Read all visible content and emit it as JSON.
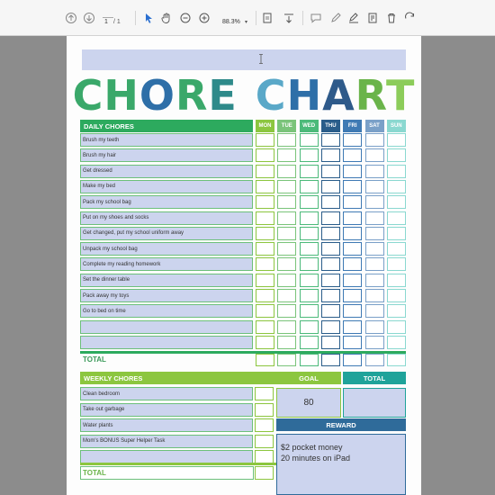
{
  "toolbar": {
    "page_current": "1",
    "page_total": "/ 1",
    "zoom": "88.3%"
  },
  "title": {
    "letters": [
      {
        "ch": "C",
        "color": "#3aa86a"
      },
      {
        "ch": "H",
        "color": "#3aa86a"
      },
      {
        "ch": "O",
        "color": "#2e6fa8"
      },
      {
        "ch": "R",
        "color": "#3aa86a"
      },
      {
        "ch": "E",
        "color": "#2e8a8a"
      },
      {
        "ch": " ",
        "color": "#000000"
      },
      {
        "ch": "C",
        "color": "#5aa8c8"
      },
      {
        "ch": "H",
        "color": "#2e6fa8"
      },
      {
        "ch": "A",
        "color": "#2e5a8a"
      },
      {
        "ch": "R",
        "color": "#6ab44a"
      },
      {
        "ch": "T",
        "color": "#8ccc5a"
      }
    ]
  },
  "daily": {
    "header": "DAILY CHORES",
    "days": [
      {
        "label": "MON",
        "color": "#8cc63f",
        "box": "#8cc63f"
      },
      {
        "label": "TUE",
        "color": "#7ac47a",
        "box": "#7ac47a"
      },
      {
        "label": "WED",
        "color": "#4cba7a",
        "box": "#4cba7a"
      },
      {
        "label": "THU",
        "color": "#2a5d8a",
        "box": "#2a5d8a"
      },
      {
        "label": "FRI",
        "color": "#3f7ab4",
        "box": "#3f7ab4"
      },
      {
        "label": "SAT",
        "color": "#7aa0c8",
        "box": "#7aa0c8"
      },
      {
        "label": "SUN",
        "color": "#8ad8d0",
        "box": "#8ad8d0"
      }
    ],
    "chores": [
      "Brush my teeth",
      "Brush my hair",
      "Get dressed",
      "Make my bed",
      "Pack my school bag",
      "Put on my shoes and socks",
      "Get changed, put my school uniform away",
      "Unpack my school bag",
      "Complete my reading homework",
      "Set the dinner table",
      "Pack away my toys",
      "Go to bed on time",
      "",
      ""
    ],
    "total_label": "TOTAL"
  },
  "weekly": {
    "header": "WEEKLY CHORES",
    "chores": [
      "Clean bedroom",
      "Take out garbage",
      "Water plants",
      "Mom's BONUS Super Helper Task"
    ],
    "total_label": "TOTAL"
  },
  "goal": {
    "header": "GOAL",
    "value": "80"
  },
  "total": {
    "header": "TOTAL",
    "value": ""
  },
  "reward": {
    "header": "REWARD",
    "line1": "$2 pocket money",
    "line2": "20 minutes on iPad"
  },
  "colors": {
    "green_header": "#2daa5e",
    "light_green_header": "#8cc63f",
    "teal_header": "#1fa39a",
    "blue_header": "#2f6b9a",
    "cell_fill": "#ccd4ee"
  }
}
